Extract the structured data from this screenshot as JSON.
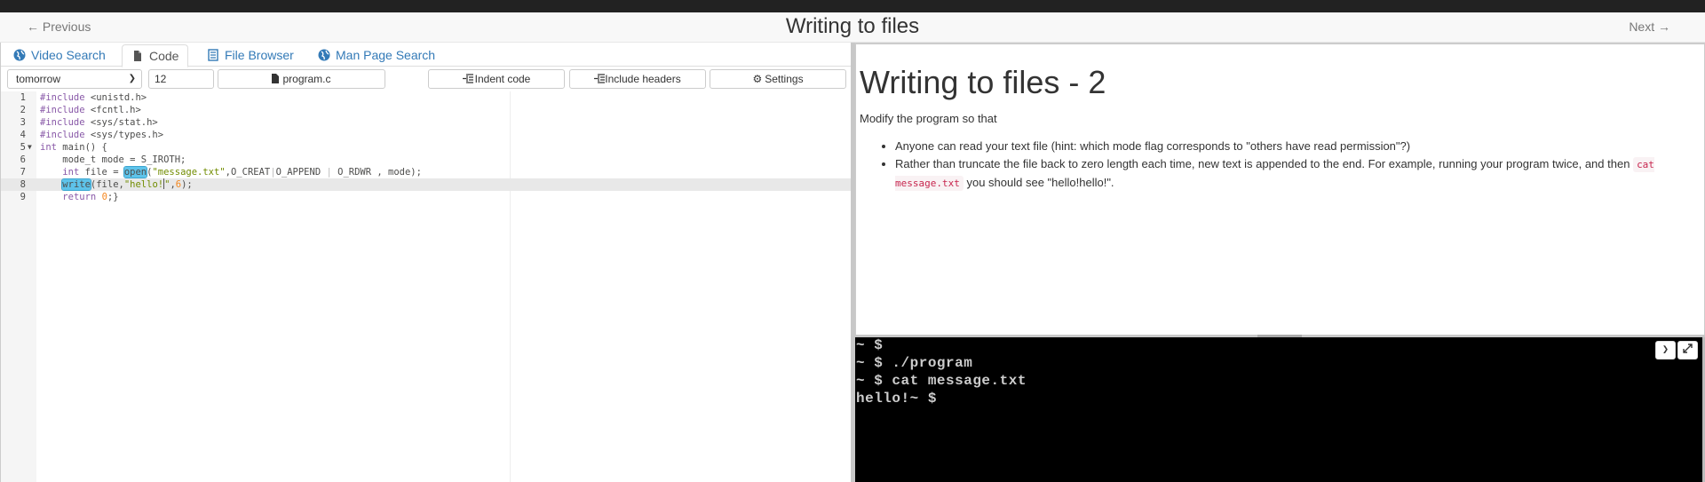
{
  "header": {
    "prev_label": "← Previous",
    "title": "Writing to files",
    "next_label": "Next →"
  },
  "tabs": [
    {
      "label": "Video Search",
      "icon": "globe-icon",
      "active": false
    },
    {
      "label": "Code",
      "icon": "file-icon",
      "active": true
    },
    {
      "label": "File Browser",
      "icon": "list-icon",
      "active": false
    },
    {
      "label": "Man Page Search",
      "icon": "globe-icon",
      "active": false
    }
  ],
  "toolbar": {
    "theme": "tomorrow",
    "font_size": "12",
    "filename": "program.c",
    "indent_label": "Indent code",
    "headers_label": "Include headers",
    "settings_label": "Settings"
  },
  "editor": {
    "active_line": 8,
    "lines": [
      {
        "n": "1",
        "text": "#include <unistd.h>"
      },
      {
        "n": "2",
        "text": "#include <fcntl.h>"
      },
      {
        "n": "3",
        "text": "#include <sys/stat.h>"
      },
      {
        "n": "4",
        "text": "#include <sys/types.h>"
      },
      {
        "n": "5",
        "text": "int main() {"
      },
      {
        "n": "6",
        "text": "    mode_t mode = S_IROTH;"
      },
      {
        "n": "7",
        "text": "    int file = open(\"message.txt\",O_CREAT|O_APPEND | O_RDWR , mode);"
      },
      {
        "n": "8",
        "text": "    write(file,\"hello!\",6);"
      },
      {
        "n": "9",
        "text": "    return 0;}"
      }
    ]
  },
  "task": {
    "title": "Writing to files - 2",
    "intro": "Modify the program so that",
    "bullets": [
      {
        "text": "Anyone can read your text file (hint: which mode flag corresponds to \"others have read permission\"?)"
      },
      {
        "text_before": "Rather than truncate the file back to zero length each time, new text is appended to the end. For example, running your program twice, and then",
        "code": "cat message.txt",
        "text_after": "you should see \"hello!hello!\"."
      }
    ]
  },
  "terminal": {
    "lines": [
      "~ $",
      "~ $ ./program",
      "~ $ cat message.txt",
      "hello!~ $"
    ],
    "run_icon": "chevron-right-icon",
    "expand_icon": "expand-icon"
  }
}
